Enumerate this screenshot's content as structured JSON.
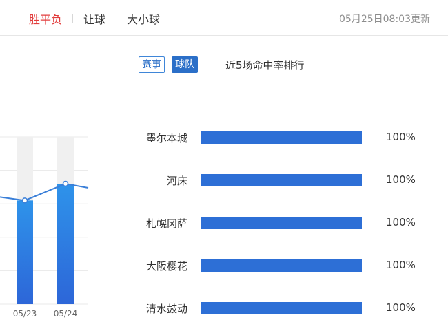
{
  "header": {
    "tabs": [
      {
        "label": "胜平负",
        "active": true
      },
      {
        "label": "让球",
        "active": false
      },
      {
        "label": "大小球",
        "active": false
      }
    ],
    "updated": "05月25日08:03更新"
  },
  "right": {
    "sub_tabs": [
      {
        "label": "赛事",
        "active": false
      },
      {
        "label": "球队",
        "active": true
      }
    ],
    "title": "近5场命中率排行",
    "rankings": [
      {
        "team": "墨尔本城",
        "rate": 100,
        "label": "100%"
      },
      {
        "team": "河床",
        "rate": 100,
        "label": "100%"
      },
      {
        "team": "札幌冈萨",
        "rate": 100,
        "label": "100%"
      },
      {
        "team": "大阪樱花",
        "rate": 100,
        "label": "100%"
      },
      {
        "team": "清水鼓动",
        "rate": 100,
        "label": "100%"
      }
    ]
  },
  "colors": {
    "accent_red": "#e23d3d",
    "brand_blue": "#2b6fc8",
    "bar_blue": "#2d6fd6",
    "line_blue": "#3a7fd8"
  },
  "chart_data": {
    "type": "bar",
    "categories": [
      "05/23",
      "05/24"
    ],
    "series": [
      {
        "values": [
          62,
          72
        ]
      }
    ],
    "line": {
      "values": [
        62,
        72
      ]
    },
    "ylim": [
      0,
      100
    ],
    "grid": true,
    "partial": "chart is cropped at the left edge; only the last two categories are visible"
  }
}
